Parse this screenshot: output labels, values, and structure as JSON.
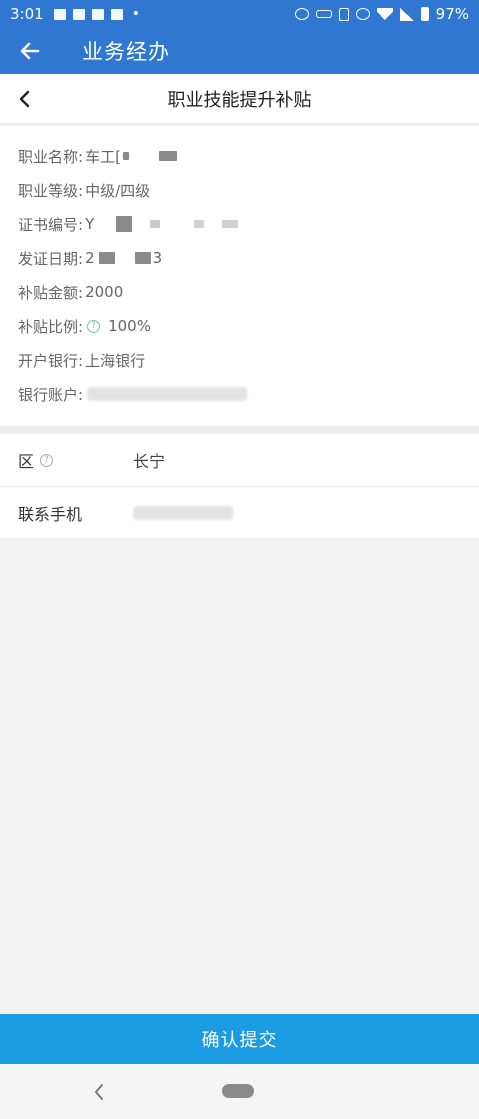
{
  "status_bar": {
    "time": "3:01",
    "dot": "•",
    "battery": "97%"
  },
  "app_bar": {
    "title": "业务经办"
  },
  "sub_header": {
    "title": "职业技能提升补贴"
  },
  "info": {
    "occupation_label": "职业名称:",
    "occupation_value": "车工[",
    "level_label": "职业等级:",
    "level_value": "中级/四级",
    "cert_label": "证书编号:",
    "cert_value": "Y",
    "date_label": "发证日期:",
    "date_value_start": "2",
    "date_value_end": "3",
    "amount_label": "补贴金额:",
    "amount_value": "2000",
    "ratio_label": "补贴比例:",
    "ratio_value": "100%",
    "bank_label": "开户银行:",
    "bank_value": "上海银行",
    "account_label": "银行账户:"
  },
  "form": {
    "district_label": "区",
    "district_value": "长宁",
    "phone_label": "联系手机"
  },
  "help_glyph": "?",
  "confirm_label": "确认提交",
  "colors": {
    "primary": "#2f77d1",
    "confirm": "#1b9ce2",
    "help": "#7fbfa5"
  }
}
